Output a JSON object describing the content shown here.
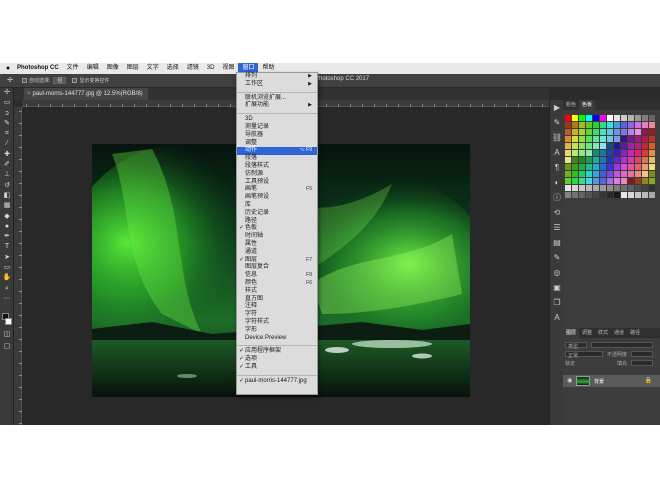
{
  "menubar": {
    "app_name": "Photoshop CC",
    "items": [
      "文件",
      "编辑",
      "图像",
      "图层",
      "文字",
      "选择",
      "滤镜",
      "3D",
      "视图",
      "窗口",
      "帮助"
    ],
    "active_index": 9
  },
  "options_bar": {
    "auto_select_label": "自动选择:",
    "auto_select_value": "组",
    "show_transform_label": "显示变换控件",
    "app_title": "Photoshop CC 2017"
  },
  "document_tab": {
    "close_glyph": "×",
    "label": "paul-morris-144777.jpg @ 12.5%(RGB/8)"
  },
  "window_menu": {
    "items": [
      {
        "label": "排列",
        "submenu": true
      },
      {
        "label": "工作区",
        "submenu": true
      },
      {
        "separator": true
      },
      {
        "label": "联机浏览扩展..."
      },
      {
        "label": "扩展功能",
        "submenu": true
      },
      {
        "separator": true
      },
      {
        "label": "3D"
      },
      {
        "label": "测量记录"
      },
      {
        "label": "导航器"
      },
      {
        "label": "调整"
      },
      {
        "label": "动作",
        "shortcut": "⌥ F9",
        "highlighted": true
      },
      {
        "label": "段落"
      },
      {
        "label": "段落样式"
      },
      {
        "label": "仿制源"
      },
      {
        "label": "工具预设"
      },
      {
        "label": "画笔",
        "shortcut": "F5"
      },
      {
        "label": "画笔预设"
      },
      {
        "label": "库"
      },
      {
        "label": "历史记录"
      },
      {
        "label": "路径"
      },
      {
        "label": "色板",
        "checked": true
      },
      {
        "label": "时间轴"
      },
      {
        "label": "属性"
      },
      {
        "label": "通道"
      },
      {
        "label": "图层",
        "checked": true,
        "shortcut": "F7"
      },
      {
        "label": "图层复合"
      },
      {
        "label": "信息",
        "shortcut": "F8"
      },
      {
        "label": "颜色",
        "shortcut": "F6"
      },
      {
        "label": "样式"
      },
      {
        "label": "直方图"
      },
      {
        "label": "注释"
      },
      {
        "label": "字符"
      },
      {
        "label": "字符样式"
      },
      {
        "label": "字形"
      },
      {
        "label": "Device Preview"
      },
      {
        "separator": true
      },
      {
        "label": "应用程序框架",
        "checked": true
      },
      {
        "label": "选项",
        "checked": true
      },
      {
        "label": "工具",
        "checked": true
      },
      {
        "separator": true
      },
      {
        "label": "paul-morris-144777.jpg",
        "checked": true
      }
    ]
  },
  "swatches_panel": {
    "tabs": [
      "颜色",
      "色板"
    ],
    "active_tab": 1
  },
  "layers_panel": {
    "tabs": [
      "图层",
      "调整",
      "样式",
      "通道",
      "路径"
    ],
    "active_tab": 0,
    "kind_label": "类型",
    "mode_label": "正常",
    "opacity_label": "不透明度",
    "lock_label": "锁定",
    "fill_label": "填充",
    "layer_name": "背景"
  }
}
